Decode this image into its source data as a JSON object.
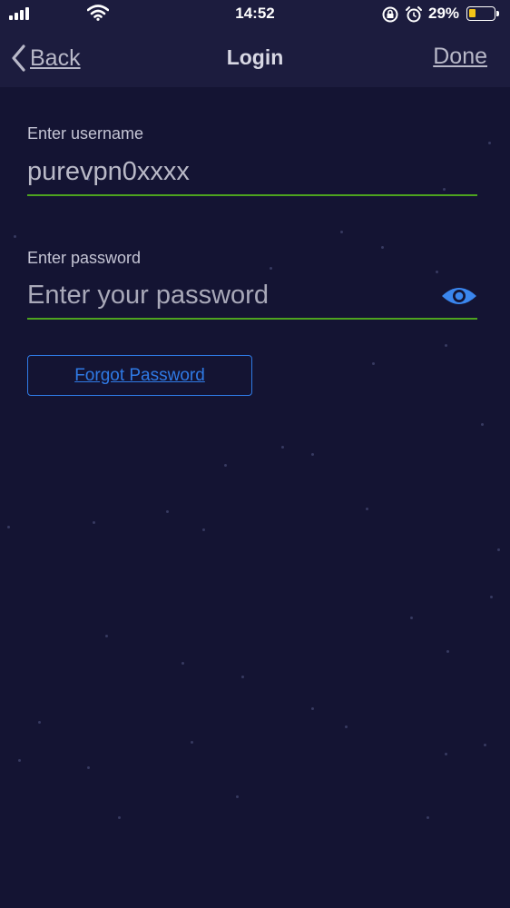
{
  "status_bar": {
    "time": "14:52",
    "battery_percent": "29%",
    "battery_level": 0.29,
    "battery_color": "#f5c518",
    "icons": [
      "cellular-signal-icon",
      "wifi-icon",
      "rotation-lock-icon",
      "alarm-icon",
      "battery-icon"
    ]
  },
  "nav": {
    "back_label": "Back",
    "title": "Login",
    "done_label": "Done"
  },
  "form": {
    "username": {
      "label": "Enter username",
      "value": "purevpn0xxxx"
    },
    "password": {
      "label": "Enter password",
      "value": "",
      "placeholder": "Enter your password",
      "toggle_icon": "eye-icon"
    },
    "forgot_label": "Forgot Password"
  },
  "colors": {
    "background": "#141433",
    "bar": "#1c1c3e",
    "accent": "#2f7ae5",
    "field_underline": "#4da31f"
  }
}
